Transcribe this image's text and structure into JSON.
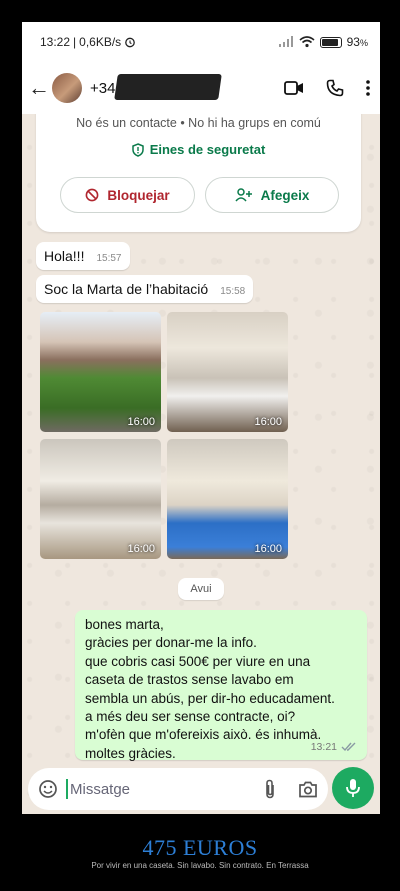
{
  "statusbar": {
    "time": "13:22",
    "speed": "0,6KB/s",
    "battery": "93"
  },
  "appbar": {
    "contact": "+34"
  },
  "infocard": {
    "info_text": "No és un contacte • No hi ha grups en comú",
    "safety_label": "Eines de seguretat",
    "block_label": "Bloquejar",
    "add_label": "Afegeix"
  },
  "messages": [
    {
      "text": "Hola!!!",
      "time": "15:57"
    },
    {
      "text": "Soc la Marta de l’habitació",
      "time": "15:58"
    }
  ],
  "photos": [
    {
      "time": "16:00"
    },
    {
      "time": "16:00"
    },
    {
      "time": "16:00"
    },
    {
      "time": "16:00"
    }
  ],
  "day_chip": "Avui",
  "outgoing": {
    "lines": [
      "bones marta,",
      "gràcies per donar-me la info.",
      "que cobris casi 500€ per viure en una",
      "caseta de trastos sense lavabo em",
      "sembla un abús, per dir-ho educadament.",
      "a més deu ser sense contracte, oi?",
      "m'ofèn que m'ofereixis això. és inhumà.",
      "moltes gràcies."
    ],
    "time": "13:21"
  },
  "composer": {
    "placeholder": "Missatge"
  },
  "caption": {
    "title": "475 EUROS",
    "subtitle": "Por vivir en una caseta. Sin lavabo. Sin contrato. En Terrassa"
  },
  "colors": {
    "accent_green": "#1daa61",
    "outgoing_bubble": "#d9fdd3",
    "block_red": "#b0262f",
    "caption_blue": "#2d7fd6"
  }
}
